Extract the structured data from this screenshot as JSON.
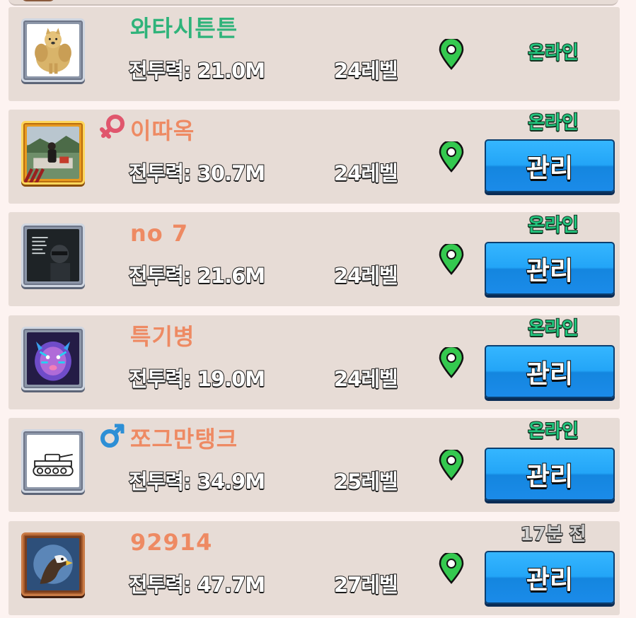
{
  "members": [
    {
      "name": "와타시튼튼",
      "name_color": "#2fb37a",
      "power": "전투력: 21.0M",
      "level": "24레벨",
      "status": "온라인",
      "status_type": "online",
      "avatar": "muscle-doge-avatar",
      "badge": null,
      "manage_label": null
    },
    {
      "name": "이따옥",
      "name_color": "#ee8a63",
      "power": "전투력: 30.7M",
      "level": "24레벨",
      "status": "온라인",
      "status_type": "online",
      "avatar": "photo-avatar-gold-frame",
      "badge": "female-symbol-icon",
      "manage_label": "관리"
    },
    {
      "name": "no 7",
      "name_color": "#ee8a63",
      "power": "전투력: 21.6M",
      "level": "24레벨",
      "status": "온라인",
      "status_type": "online",
      "avatar": "masked-person-avatar",
      "badge": null,
      "manage_label": "관리"
    },
    {
      "name": "특기병",
      "name_color": "#ee8a63",
      "power": "전투력: 19.0M",
      "level": "24레벨",
      "status": "온라인",
      "status_type": "online",
      "avatar": "neon-tiger-avatar",
      "badge": null,
      "manage_label": "관리"
    },
    {
      "name": "쪼그만탱크",
      "name_color": "#ee8a63",
      "power": "전투력: 34.9M",
      "level": "25레벨",
      "status": "온라인",
      "status_type": "online",
      "avatar": "tank-drawing-avatar",
      "badge": "male-symbol-icon",
      "manage_label": "관리"
    },
    {
      "name": "92914",
      "name_color": "#ee8a63",
      "power": "전투력: 47.7M",
      "level": "27레벨",
      "status": "17분 전",
      "status_type": "offline",
      "avatar": "eagle-avatar-bronze-frame",
      "badge": null,
      "manage_label": "관리"
    }
  ],
  "colors": {
    "online": "#22c47d",
    "offline": "#cfcfcf",
    "pin": "#34c94f",
    "button": "#23a5f7"
  }
}
